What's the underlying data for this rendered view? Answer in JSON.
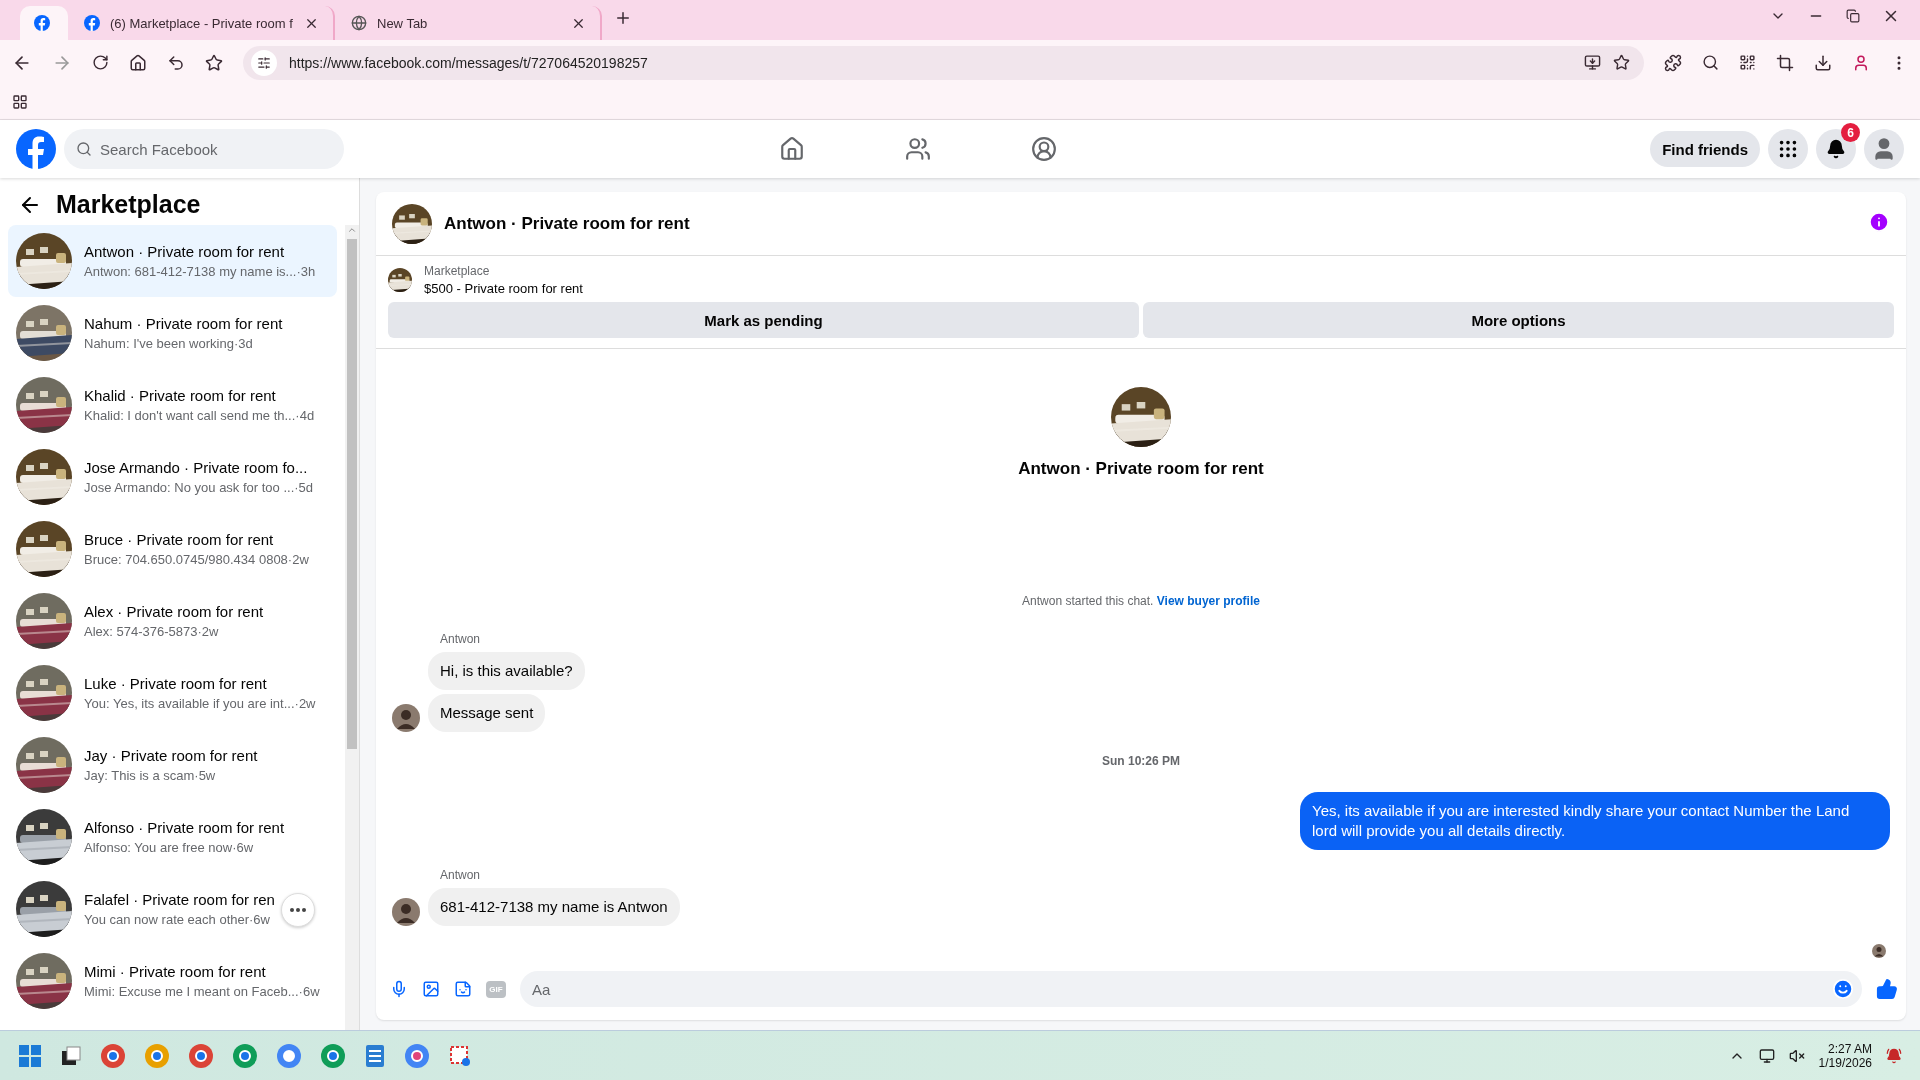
{
  "browser": {
    "tabs": [
      {
        "kind": "pinned",
        "selected": true
      },
      {
        "kind": "page",
        "title": "(6) Marketplace - Private room f",
        "selected": false
      },
      {
        "kind": "newtab",
        "title": "New Tab",
        "selected": false
      }
    ],
    "url": "https://www.facebook.com/messages/t/727064520198257"
  },
  "header": {
    "search": {
      "placeholder": "Search Facebook"
    },
    "find_friends": "Find friends",
    "notification_count": "6"
  },
  "sidebar": {
    "title": "Marketplace",
    "conversations": [
      {
        "name": "Antwon · Private room for rent",
        "preview": "Antwon: 681-412-7138 my name is...",
        "time": "·3h",
        "selected": true
      },
      {
        "name": "Nahum · Private room for rent",
        "preview": "Nahum: I've been working",
        "time": "·3d",
        "selected": false
      },
      {
        "name": "Khalid · Private room for rent",
        "preview": "Khalid: I don't want call send me th...",
        "time": "·4d",
        "selected": false
      },
      {
        "name": "Jose Armando · Private room fo...",
        "preview": "Jose Armando: No you ask for too ...",
        "time": "·5d",
        "selected": false
      },
      {
        "name": "Bruce · Private room for rent",
        "preview": "Bruce: 704.650.0745/980.434 0808",
        "time": "·2w",
        "selected": false
      },
      {
        "name": "Alex · Private room for rent",
        "preview": "Alex: 574-376-5873",
        "time": "·2w",
        "selected": false
      },
      {
        "name": "Luke · Private room for rent",
        "preview": "You: Yes, its available if you are int...",
        "time": "·2w",
        "selected": false
      },
      {
        "name": "Jay · Private room for rent",
        "preview": "Jay: This is a scam",
        "time": "·5w",
        "selected": false
      },
      {
        "name": "Alfonso · Private room for rent",
        "preview": "Alfonso: You are free now",
        "time": "·6w",
        "selected": false
      },
      {
        "name": "Falafel · Private room for ren",
        "preview": "You can now rate each other",
        "time": "·6w",
        "selected": false,
        "menu_button": true
      },
      {
        "name": "Mimi · Private room for rent",
        "preview": "Mimi: Excuse me I meant on Faceb...",
        "time": "·6w",
        "selected": false
      }
    ]
  },
  "chat": {
    "title": "Antwon · Private room for rent",
    "listing": {
      "source": "Marketplace",
      "title": "$500 - Private room for rent",
      "buttons": [
        "Mark as pending",
        "More options"
      ]
    },
    "profile_title": "Antwon · Private room for rent",
    "messages": [
      {
        "kind": "system",
        "text": "Antwon started this chat.",
        "link": "View buyer profile"
      },
      {
        "kind": "sender",
        "text": "Antwon"
      },
      {
        "kind": "incoming",
        "text": "Hi, is this available?",
        "avatar": false
      },
      {
        "kind": "incoming",
        "text": "Message sent",
        "avatar": true
      },
      {
        "kind": "timestamp",
        "text": "Sun 10:26 PM"
      },
      {
        "kind": "outgoing",
        "text": "Yes, its available if you are interested kindly share your contact Number the Land lord will provide you all details directly."
      },
      {
        "kind": "sender",
        "text": "Antwon"
      },
      {
        "kind": "incoming",
        "text": "681-412-7138 my name is Antwon",
        "avatar": true
      },
      {
        "kind": "seen"
      }
    ],
    "composer": {
      "placeholder": "Aa",
      "gif_label": "GIF"
    }
  },
  "taskbar": {
    "time": "2:27 AM",
    "date": "1/19/2026"
  }
}
